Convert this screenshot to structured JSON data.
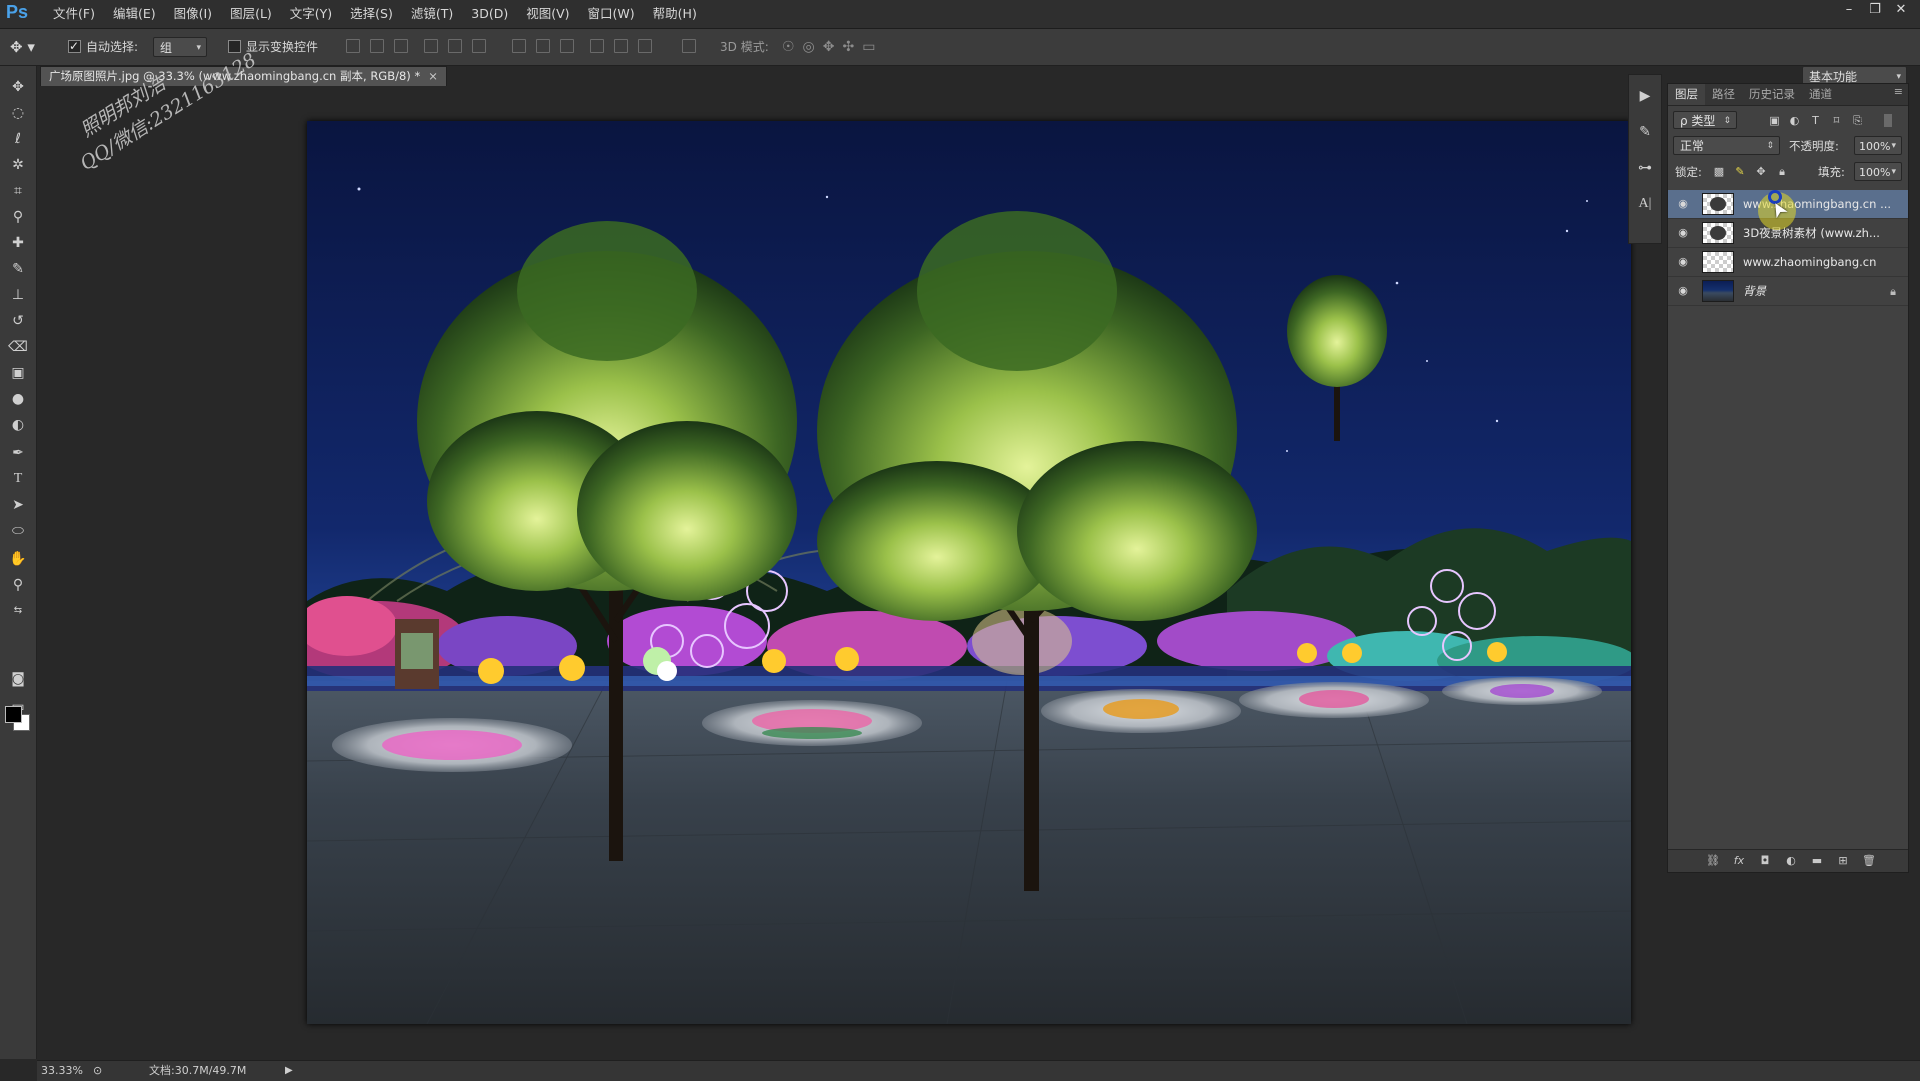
{
  "app": {
    "logo": "Ps",
    "menu": [
      "文件(F)",
      "编辑(E)",
      "图像(I)",
      "图层(L)",
      "文字(Y)",
      "选择(S)",
      "滤镜(T)",
      "3D(D)",
      "视图(V)",
      "窗口(W)",
      "帮助(H)"
    ],
    "window_controls": [
      "–",
      "❐",
      "✕"
    ]
  },
  "options_bar": {
    "auto_select_label": "自动选择:",
    "auto_select_checked": true,
    "auto_select_value": "组",
    "show_transform_label": "显示变换控件",
    "show_transform_checked": false,
    "mode_3d_label": "3D 模式:",
    "workspace": "基本功能"
  },
  "document": {
    "tab_title": "广场原图照片.jpg @ 33.3% (www.zhaomingbang.cn 副本, RGB/8) *",
    "close_glyph": "×",
    "watermark_line1": "照明邦刘浩",
    "watermark_line2": "QQ/微信:2321163128"
  },
  "status": {
    "zoom": "33.33%",
    "doc_size": "文档:30.7M/49.7M"
  },
  "layers_panel": {
    "tabs": [
      "图层",
      "路径",
      "历史记录",
      "通道"
    ],
    "active_tab": 0,
    "filter_label": "ρ 类型",
    "blend_mode": "正常",
    "opacity_label": "不透明度:",
    "opacity_value": "100%",
    "lock_label": "锁定:",
    "fill_label": "填充:",
    "fill_value": "100%",
    "layers": [
      {
        "name": "www.zhaomingbang.cn ...",
        "selected": true,
        "thumb": "tree",
        "locked": false,
        "italic": false
      },
      {
        "name": "3D夜景树素材 (www.zh...",
        "selected": false,
        "thumb": "tree",
        "locked": false,
        "italic": false
      },
      {
        "name": "www.zhaomingbang.cn",
        "selected": false,
        "thumb": "checker",
        "locked": false,
        "italic": false
      },
      {
        "name": "背景",
        "selected": false,
        "thumb": "night",
        "locked": true,
        "italic": true
      }
    ]
  },
  "colors": {
    "accent": "#4aa2ea",
    "selected_layer": "#5a6f8d",
    "foreground": "#000000",
    "background": "#ffffff"
  }
}
